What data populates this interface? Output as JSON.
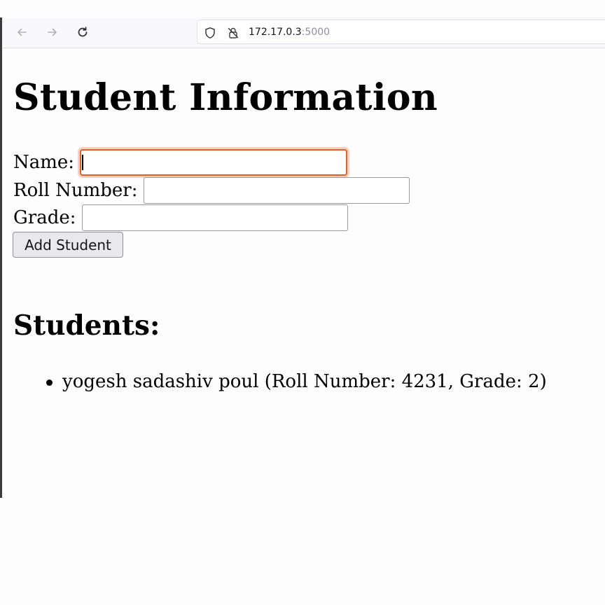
{
  "browser": {
    "url_host": "172.17.0.3",
    "url_port": ":5000",
    "icons": {
      "back": "arrow-left-icon",
      "forward": "arrow-right-icon",
      "reload": "reload-icon",
      "tracking_protection": "shield-icon",
      "insecure_connection": "lock-slash-icon"
    }
  },
  "page": {
    "title": "Student Information",
    "form": {
      "name_label": "Name:",
      "name_value": "",
      "roll_label": "Roll Number:",
      "roll_value": "",
      "grade_label": "Grade:",
      "grade_value": "",
      "submit_label": "Add Student"
    },
    "students_heading": "Students:",
    "students": [
      {
        "text": "yogesh sadashiv poul (Roll Number: 4231, Grade: 2)"
      }
    ]
  },
  "colors": {
    "focus_ring": "#e2602a",
    "button_bg": "#e9e9ed",
    "page_bg": "#fdfdfd"
  }
}
